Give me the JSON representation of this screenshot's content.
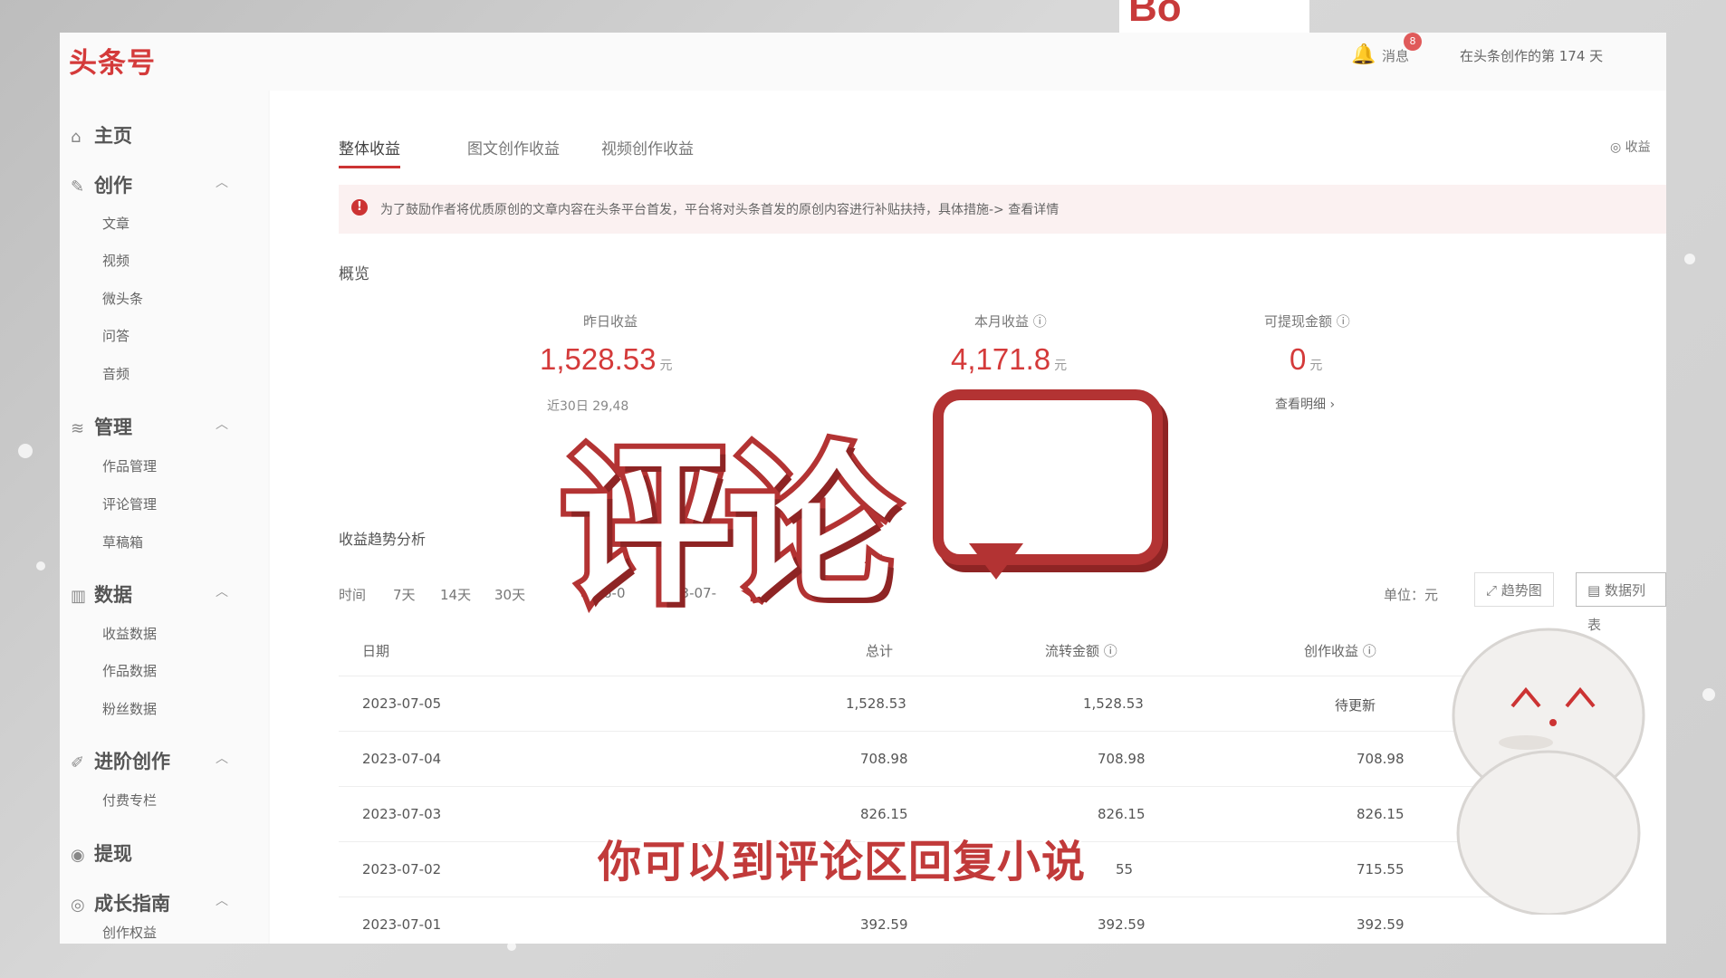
{
  "topbar": {
    "logo": "头条号",
    "bell_badge": "8",
    "messages_label": "消息",
    "creator_days": "在头条创作的第 174 天"
  },
  "sidebar": {
    "home": "主页",
    "create": "创作",
    "create_items": [
      "文章",
      "视频",
      "微头条",
      "问答",
      "音频"
    ],
    "manage": "管理",
    "manage_items": [
      "作品管理",
      "评论管理",
      "草稿箱"
    ],
    "data": "数据",
    "data_items": [
      "收益数据",
      "作品数据",
      "粉丝数据"
    ],
    "advanced": "进阶创作",
    "advanced_items": [
      "付费专栏"
    ],
    "withdraw": "提现",
    "growth": "成长指南",
    "growth_items": [
      "创作权益"
    ]
  },
  "tabs": [
    "整体收益",
    "图文创作收益",
    "视频创作收益"
  ],
  "top_right_link": "收益",
  "notice": "为了鼓励作者将优质原创的文章内容在头条平台首发，平台将对头条首发的原创内容进行补贴扶持，具体措施-> 查看详情",
  "overview": {
    "title": "概览",
    "yesterday_label": "昨日收益",
    "yesterday_value": "1,528.53",
    "month_label": "本月收益",
    "month_value": "4,171.8",
    "withdraw_label": "可提现金额",
    "withdraw_value": "0",
    "unit": "元",
    "recent_30": "近30日 29,48",
    "view_detail": "查看明细 ›"
  },
  "trend": {
    "title": "收益趋势分析",
    "time_label": "时间",
    "ranges": [
      "7天",
      "14天",
      "30天"
    ],
    "date_frag_1": "6-0",
    "date_frag_2": "23-07-",
    "unit_label": "单位：元",
    "trend_btn": "趋势图",
    "table_btn": "数据列表"
  },
  "table": {
    "headers": [
      "日期",
      "总计",
      "流转金额",
      "创作收益"
    ],
    "rows": [
      [
        "2023-07-05",
        "1,528.53",
        "1,528.53",
        "待更新"
      ],
      [
        "2023-07-04",
        "708.98",
        "708.98",
        "708.98"
      ],
      [
        "2023-07-03",
        "826.15",
        "826.15",
        "826.15"
      ],
      [
        "2023-07-02",
        "",
        "55",
        "715.55"
      ],
      [
        "2023-07-01",
        "392.59",
        "392.59",
        "392.59"
      ]
    ]
  },
  "overlay": {
    "big_title": "评论",
    "subtitle": "你可以到评论区回复小说"
  },
  "colors": {
    "accent": "#d43a3a",
    "overlay_red": "#b33333"
  }
}
